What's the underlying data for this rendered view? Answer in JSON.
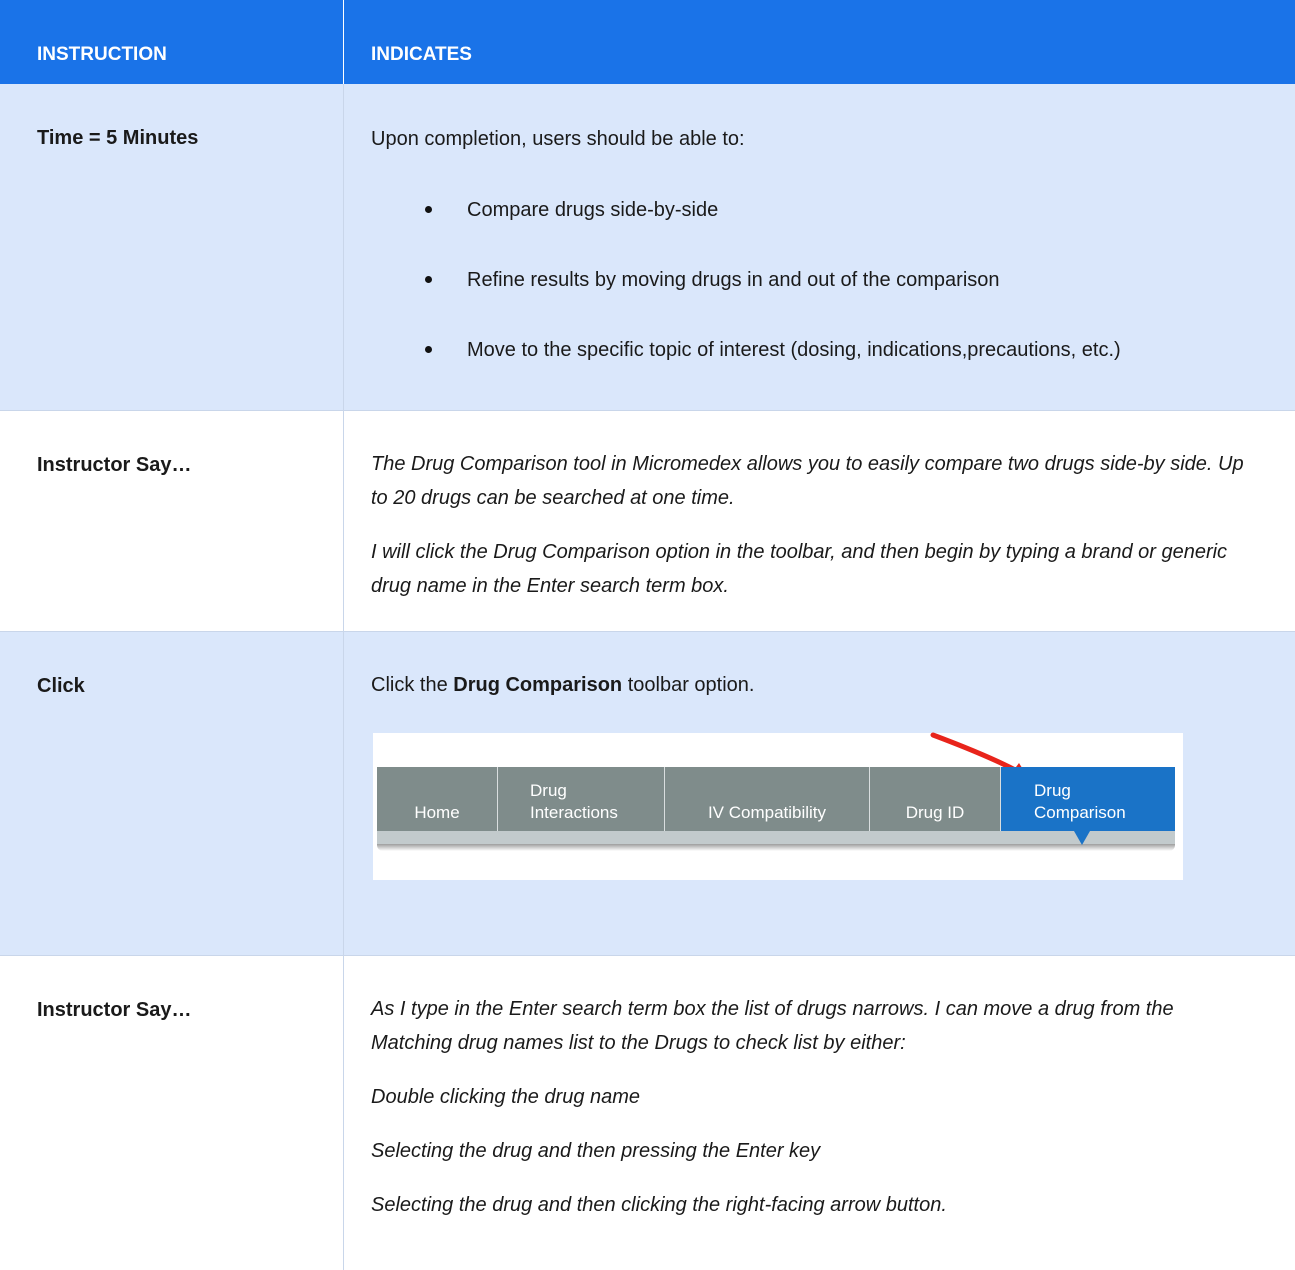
{
  "header": {
    "col1": "INSTRUCTION",
    "col2": "INDICATES"
  },
  "rows": [
    {
      "instruction": "Time = 5 Minutes",
      "intro": "Upon completion, users should be able to:",
      "bullets": [
        "Compare drugs side-by-side",
        "Refine results by moving drugs in and out of the comparison",
        "Move to the specific topic of interest (dosing, indications,precautions, etc.)"
      ]
    },
    {
      "instruction": "Instructor Say…",
      "paragraphs": [
        "The Drug Comparison tool in Micromedex allows you to easily compare two drugs side-by side. Up to 20 drugs can be searched at one time.",
        "I will click the Drug Comparison option in the toolbar, and then begin by typing a brand or generic drug name in the Enter search term box."
      ]
    },
    {
      "instruction": "Click",
      "text_before": "Click the ",
      "text_bold": "Drug Comparison",
      "text_after": " toolbar option."
    },
    {
      "instruction": "Instructor Say…",
      "paragraphs": [
        "As I type in the Enter search term box the list of drugs narrows. I can move a drug from the Matching drug names list to the Drugs to check list by either:",
        "Double clicking the drug name",
        "Selecting the drug and then pressing the Enter key",
        "Selecting the drug and then clicking the right-facing arrow button."
      ]
    }
  ],
  "toolbar": {
    "items": [
      {
        "line1": "",
        "line2": "Home"
      },
      {
        "line1": "Drug",
        "line2": "Interactions"
      },
      {
        "line1": "",
        "line2": "IV Compatibility"
      },
      {
        "line1": "",
        "line2": "Drug ID"
      },
      {
        "line1": "Drug",
        "line2": "Comparison"
      }
    ],
    "active_color": "#1a73c7",
    "bar_color": "#7f8c8b",
    "arrow_color": "#e8241b"
  },
  "colors": {
    "header_bg": "#1a73e8",
    "shaded_bg": "#dae7fb"
  }
}
